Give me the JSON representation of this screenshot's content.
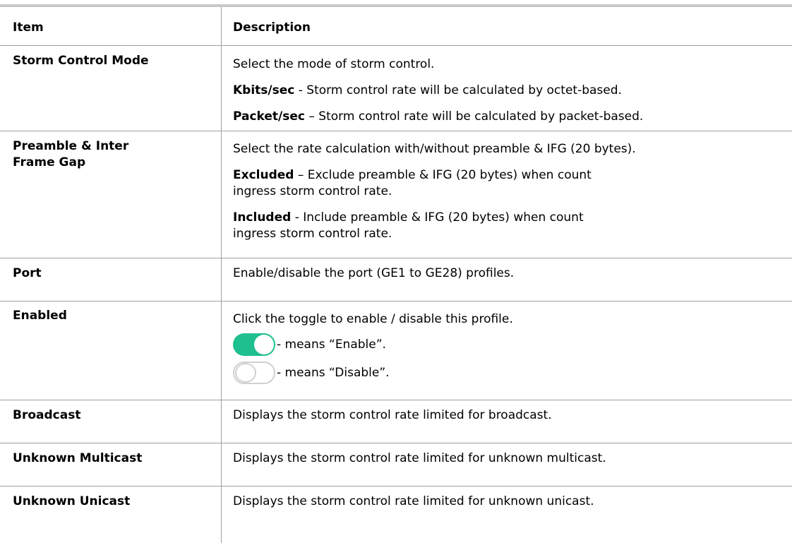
{
  "header": {
    "item": "Item",
    "description": "Description"
  },
  "rows": [
    {
      "item": "Storm Control Mode",
      "intro": "Select the mode of storm control.",
      "opt1_term": "Kbits/sec",
      "opt1_text": " - Storm control rate will be calculated by octet-based.",
      "opt2_term": "Packet/sec",
      "opt2_text": " – Storm control rate will be calculated by packet-based."
    },
    {
      "item_line1": "Preamble & Inter",
      "item_line2": "Frame Gap",
      "intro": "Select the rate calculation with/without preamble & IFG (20 bytes).",
      "opt1_term": "Excluded",
      "opt1_text": " – Exclude preamble & IFG (20 bytes) when count ingress storm control rate.",
      "opt2_term": "Included",
      "opt2_text": " - Include preamble & IFG (20 bytes) when count ingress storm control rate."
    },
    {
      "item": "Port",
      "text": "Enable/disable the port (GE1 to GE28) profiles."
    },
    {
      "item": "Enabled",
      "intro": "Click the toggle to enable / disable this profile.",
      "on_text": " - means “Enable”.",
      "off_text": " - means “Disable”."
    },
    {
      "item": "Broadcast",
      "text": "Displays the storm control rate limited for broadcast."
    },
    {
      "item": "Unknown Multicast",
      "text": "Displays the storm control rate limited for unknown multicast."
    },
    {
      "item": "Unknown Unicast",
      "text": "Displays the storm control rate limited for unknown unicast."
    }
  ],
  "colors": {
    "toggle_on": "#1fbf8f",
    "toggle_off_border": "#d0d0d0",
    "rule": "#a0a0a0"
  }
}
